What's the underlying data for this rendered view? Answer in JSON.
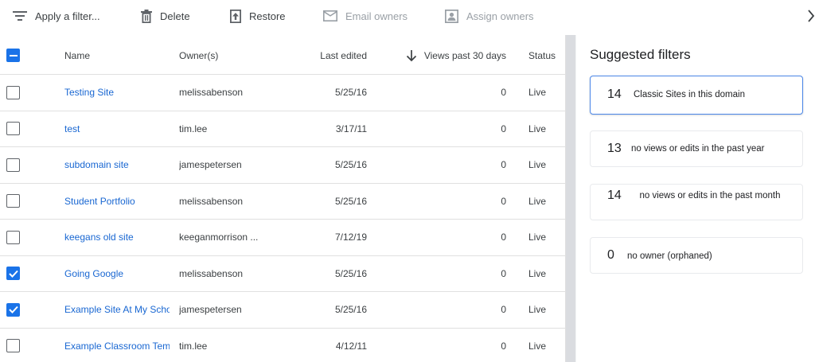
{
  "toolbar": {
    "apply_filter": "Apply a filter...",
    "delete": "Delete",
    "restore": "Restore",
    "email_owners": "Email owners",
    "assign_owners": "Assign owners"
  },
  "table": {
    "columns": {
      "name": "Name",
      "owners": "Owner(s)",
      "last_edited": "Last edited",
      "views": "Views past 30 days",
      "status": "Status"
    },
    "rows": [
      {
        "name": "Testing Site",
        "owner": "melissabenson",
        "edited": "5/25/16",
        "views": "0",
        "status": "Live",
        "checked": false
      },
      {
        "name": "test",
        "owner": "tim.lee",
        "edited": "3/17/11",
        "views": "0",
        "status": "Live",
        "checked": false
      },
      {
        "name": "subdomain site",
        "owner": "jamespetersen",
        "edited": "5/25/16",
        "views": "0",
        "status": "Live",
        "checked": false
      },
      {
        "name": "Student Portfolio",
        "owner": "melissabenson",
        "edited": "5/25/16",
        "views": "0",
        "status": "Live",
        "checked": false
      },
      {
        "name": "keegans old site",
        "owner": "keeganmorrison ...",
        "edited": "7/12/19",
        "views": "0",
        "status": "Live",
        "checked": false
      },
      {
        "name": "Going Google",
        "owner": "melissabenson",
        "edited": "5/25/16",
        "views": "0",
        "status": "Live",
        "checked": true
      },
      {
        "name": "Example Site At My School",
        "owner": "jamespetersen",
        "edited": "5/25/16",
        "views": "0",
        "status": "Live",
        "checked": true
      },
      {
        "name": "Example Classroom Template",
        "owner": "tim.lee",
        "edited": "4/12/11",
        "views": "0",
        "status": "Live",
        "checked": false
      }
    ]
  },
  "suggested": {
    "title": "Suggested filters",
    "cards": [
      {
        "count": "14",
        "label": "Classic Sites in this domain",
        "selected": true
      },
      {
        "count": "13",
        "label": "no views or edits in the past year",
        "selected": false
      },
      {
        "count": "14",
        "label": "no views or edits in the past month",
        "selected": false
      },
      {
        "count": "0",
        "label": "no owner (orphaned)",
        "selected": false
      }
    ]
  },
  "icons": {
    "filter": "filter-list-icon",
    "delete": "trash-icon",
    "restore": "restore-upload-icon",
    "email": "mail-icon",
    "assign": "assign-person-icon",
    "sort": "arrow-down-icon",
    "next": "chevron-right-icon"
  },
  "colors": {
    "link": "#1967d2",
    "accent": "#1a73e8",
    "disabled": "#9aa0a6"
  }
}
